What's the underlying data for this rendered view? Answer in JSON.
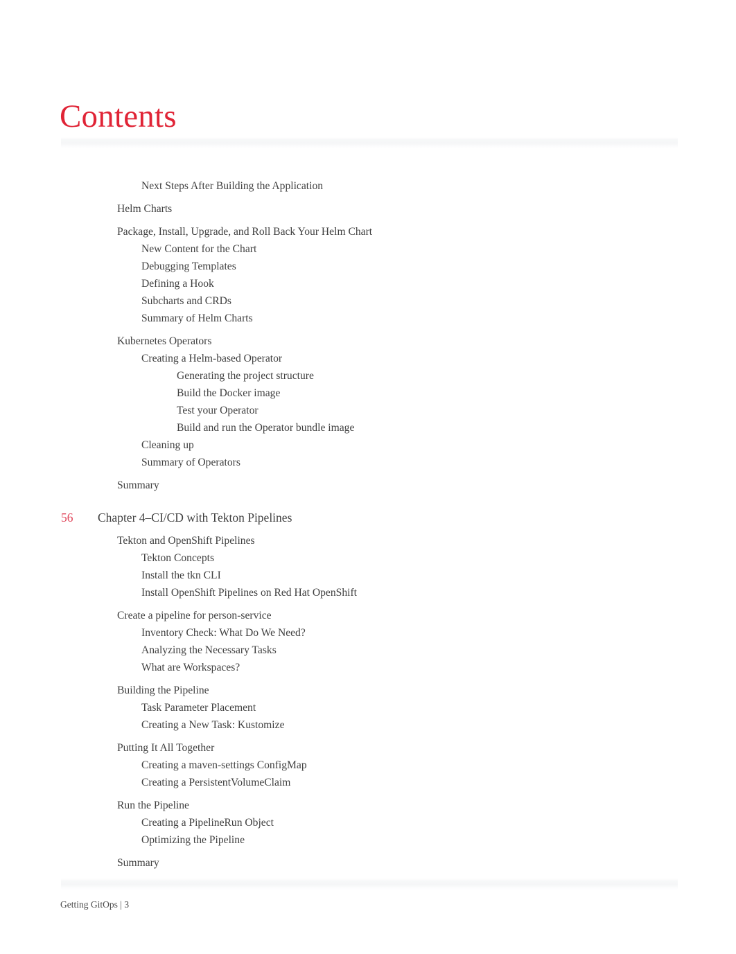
{
  "document": {
    "title": "Contents",
    "footer_text": "Getting GitOps | 3",
    "accent_color": "#E02436",
    "page_number_color": "#E0455A",
    "body_text_color": "#404040"
  },
  "toc": {
    "entries": [
      {
        "level": 2,
        "label": "Next Steps After Building the Application"
      },
      {
        "level": 1,
        "label": "Helm Charts"
      },
      {
        "level": 1,
        "label": "Package, Install, Upgrade, and Roll Back Your Helm Chart"
      },
      {
        "level": 2,
        "label": "New Content for the Chart"
      },
      {
        "level": 2,
        "label": "Debugging Templates"
      },
      {
        "level": 2,
        "label": "Defining a Hook"
      },
      {
        "level": 2,
        "label": "Subcharts and CRDs"
      },
      {
        "level": 2,
        "label": "Summary of Helm Charts"
      },
      {
        "level": 1,
        "label": "Kubernetes Operators"
      },
      {
        "level": 2,
        "label": "Creating a Helm-based Operator"
      },
      {
        "level": 3,
        "label": "Generating the project structure"
      },
      {
        "level": 3,
        "label": "Build the Docker image"
      },
      {
        "level": 3,
        "label": "Test your Operator"
      },
      {
        "level": 3,
        "label": "Build and run the Operator bundle image"
      },
      {
        "level": 2,
        "label": "Cleaning up"
      },
      {
        "level": 2,
        "label": "Summary of Operators"
      },
      {
        "level": 1,
        "label": "Summary"
      }
    ],
    "chapter": {
      "page_number": "56",
      "title": "Chapter 4–CI/CD with Tekton Pipelines"
    },
    "chapter_entries": [
      {
        "level": 1,
        "label": "Tekton and OpenShift Pipelines"
      },
      {
        "level": 2,
        "label": "Tekton Concepts"
      },
      {
        "level": 2,
        "label": "Install the tkn CLI"
      },
      {
        "level": 2,
        "label": "Install OpenShift Pipelines on Red Hat OpenShift"
      },
      {
        "level": 1,
        "label": "Create a pipeline for person-service"
      },
      {
        "level": 2,
        "label": "Inventory Check: What Do We Need?"
      },
      {
        "level": 2,
        "label": "Analyzing the Necessary Tasks"
      },
      {
        "level": 2,
        "label": "What are Workspaces?"
      },
      {
        "level": 1,
        "label": "Building the Pipeline"
      },
      {
        "level": 2,
        "label": "Task Parameter Placement"
      },
      {
        "level": 2,
        "label": "Creating a New Task: Kustomize"
      },
      {
        "level": 1,
        "label": "Putting It All Together"
      },
      {
        "level": 2,
        "label": "Creating a maven-settings ConfigMap"
      },
      {
        "level": 2,
        "label": "Creating a PersistentVolumeClaim"
      },
      {
        "level": 1,
        "label": "Run the Pipeline"
      },
      {
        "level": 2,
        "label": "Creating a PipelineRun Object"
      },
      {
        "level": 2,
        "label": "Optimizing the Pipeline"
      },
      {
        "level": 1,
        "label": "Summary"
      }
    ]
  }
}
